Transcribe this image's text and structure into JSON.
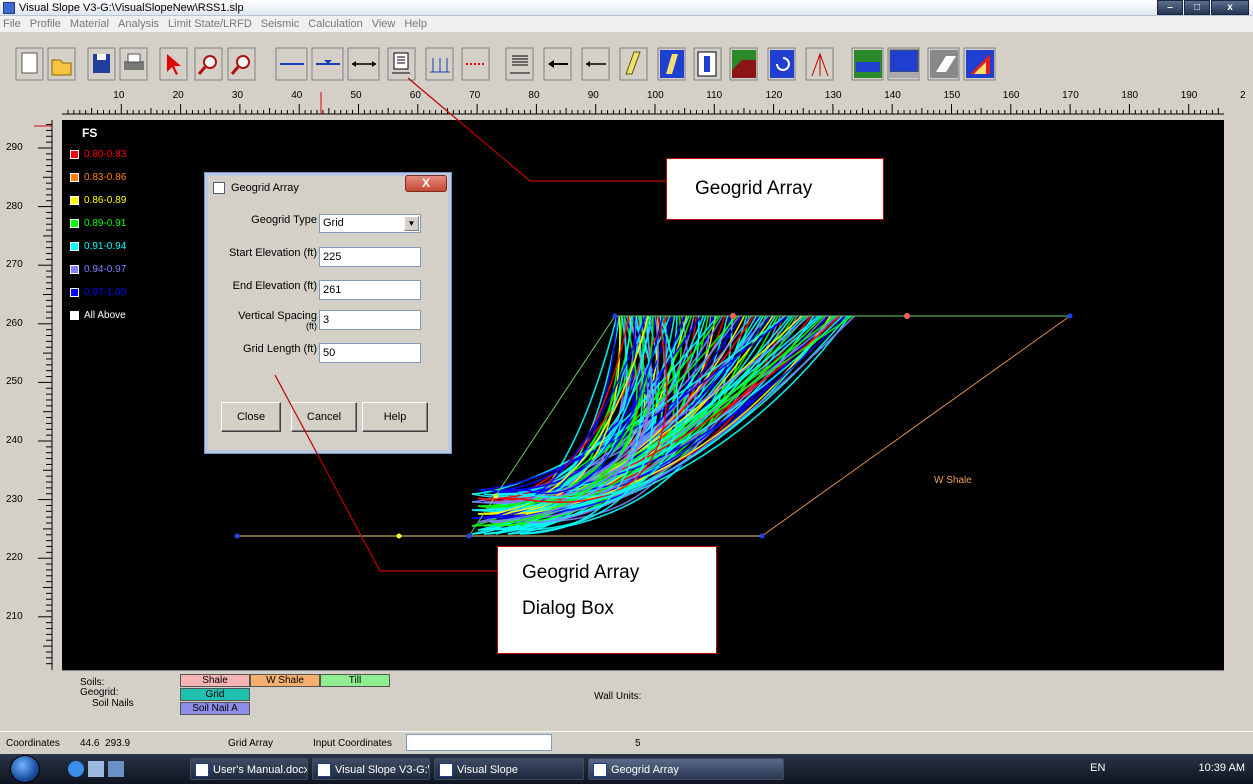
{
  "window": {
    "title": "Visual Slope V3-G:\\VisualSlopeNew\\RSS1.slp",
    "buttons": [
      "–",
      "□",
      "x"
    ]
  },
  "menu": [
    "File",
    "Profile",
    "Material",
    "Analysis",
    "Limit State/LRFD",
    "Seismic",
    "Calculation",
    "View",
    "Help"
  ],
  "ruler": {
    "ticks": [
      "10",
      "20",
      "30",
      "40",
      "50",
      "60",
      "70",
      "80",
      "90",
      "100",
      "110",
      "120",
      "130",
      "140",
      "150",
      "160",
      "170",
      "180",
      "190",
      "2"
    ]
  },
  "vruler": {
    "ticks": [
      "290",
      "280",
      "270",
      "260",
      "250",
      "240",
      "230",
      "220",
      "210"
    ]
  },
  "legend": {
    "title": "FS",
    "items": [
      {
        "label": "0.80-0.83",
        "color": "#ff0000"
      },
      {
        "label": "0.83-0.86",
        "color": "#ff8000"
      },
      {
        "label": "0.86-0.89",
        "color": "#ffff00"
      },
      {
        "label": "0.89-0.91",
        "color": "#00ff00"
      },
      {
        "label": "0.91-0.94",
        "color": "#00ffff"
      },
      {
        "label": "0.94-0.97",
        "color": "#8080ff"
      },
      {
        "label": "0.97-1.00",
        "color": "#0000ff"
      },
      {
        "label": "All Above",
        "color": "#ffffff"
      }
    ]
  },
  "canvas": {
    "soil_label": "W Shale"
  },
  "dialog": {
    "title": "Geogrid Array",
    "close_x": "X",
    "fields": {
      "type_label": "Geogrid Type",
      "type_value": "Grid",
      "start_label": "Start Elevation (ft)",
      "start_value": "225",
      "end_label": "End Elevation (ft)",
      "end_value": "261",
      "spacing_label_1": "Vertical Spacing",
      "spacing_label_2": "(ft)",
      "spacing_value": "3",
      "length_label": "Grid Length (ft)",
      "length_value": "50"
    },
    "buttons": {
      "close": "Close",
      "cancel": "Cancel",
      "help": "Help"
    }
  },
  "callouts": {
    "toolbar": "Geogrid Array",
    "dialog_line1": "Geogrid Array",
    "dialog_line2": "Dialog Box"
  },
  "soilbar": {
    "soils_label": "Soils:",
    "geogrid_label": "Geogrid:",
    "nails_label": "Soil Nails",
    "soils": [
      {
        "name": "Shale",
        "color": "#f4b4b4"
      },
      {
        "name": "W Shale",
        "color": "#f5b070"
      },
      {
        "name": "Till",
        "color": "#90ee90"
      }
    ],
    "geogrid": {
      "name": "Grid",
      "color": "#20c0b0"
    },
    "nail": {
      "name": "Soil Nail A",
      "color": "#8e8ee8"
    },
    "wall_units": "Wall Units:"
  },
  "status": {
    "coords_label": "Coordinates",
    "coords_value": "44.6  293.9",
    "mode": "Grid Array",
    "input_label": "Input Coordinates",
    "count": "5"
  },
  "taskbar": {
    "items": [
      "User's Manual.docx ...",
      "Visual Slope V3-G:\\V...",
      "Visual Slope",
      "Geogrid Array"
    ],
    "tray_lang": "EN",
    "clock": "10:39 AM"
  }
}
